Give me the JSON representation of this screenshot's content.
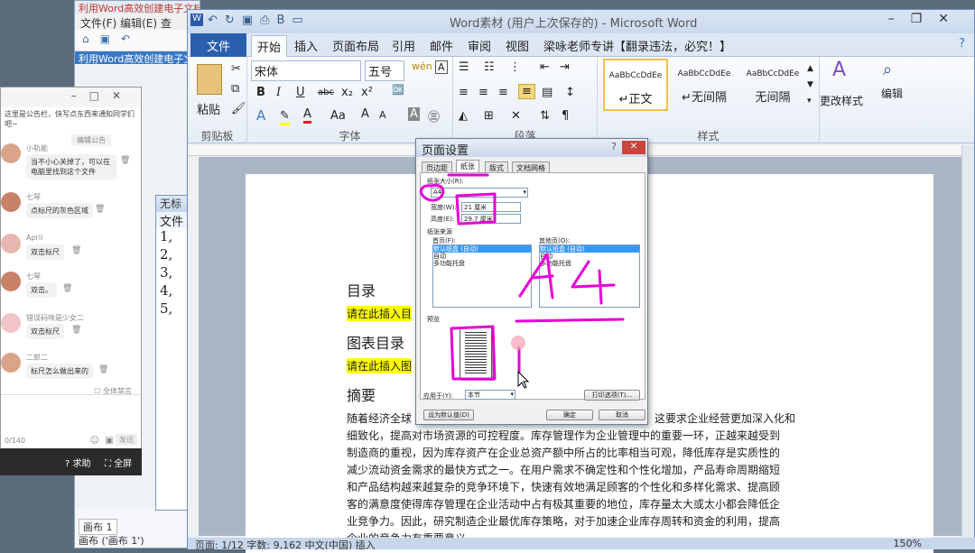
{
  "xmind": {
    "title": "利用Word高效创建电子文档.xmind",
    "menu": "文件(F)  编辑(E)  查",
    "tab": "利用Word高效创建电子文档",
    "sheet_tab": "画布 1",
    "status": "画布 ('画布 1')"
  },
  "subwin": {
    "title": "无标",
    "menu": "文件",
    "lines": [
      "1,",
      "2,",
      "3,",
      "4,",
      "5,"
    ]
  },
  "chat": {
    "notice": "这里是公告栏，快写点东西来通知同学们吧~",
    "notice_badge": "编辑公告",
    "messages": [
      {
        "name": "小轨能",
        "text": "当不小心关掉了，可以在电脑里找到这个文件"
      },
      {
        "name": "七琴",
        "text": "点标尺的灰色区域"
      },
      {
        "name": "April",
        "text": "双击标尺"
      },
      {
        "name": "七琴",
        "text": "双击。"
      },
      {
        "name": "错误码咪是少女二",
        "text": "双击标尺"
      },
      {
        "name": "二郎二",
        "text": "标尺怎么做出来的"
      }
    ],
    "mute_all": "全体禁言",
    "counter": "0/140",
    "send": "发送",
    "help": "求助",
    "fullscreen": "全屏"
  },
  "word": {
    "title": "Word素材 (用户上次保存的) - Microsoft Word",
    "tabs": [
      "文件",
      "开始",
      "插入",
      "页面布局",
      "引用",
      "邮件",
      "审阅",
      "视图",
      "梁咏老师专讲【翻录违法，必究！】"
    ],
    "clipboard": {
      "paste": "粘贴",
      "label": "剪贴板"
    },
    "font": {
      "name": "宋体",
      "size": "五号",
      "label": "字体"
    },
    "paragraph_label": "段落",
    "styles": {
      "label": "样式",
      "items": [
        {
          "preview": "AaBbCcDdEe",
          "name": "↵正文"
        },
        {
          "preview": "AaBbCcDdEe",
          "name": "↵无间隔"
        },
        {
          "preview": "AaBbCcDdEe",
          "name": "无间隔"
        }
      ],
      "change": "更改样式",
      "edit": "编辑"
    },
    "doc": {
      "toc": "目录",
      "toc_placeholder": "请在此插入目",
      "fig_toc": "图表目录",
      "fig_placeholder": "请在此插入图",
      "abstract": "摘要",
      "para_start": "随着经济全球",
      "para_right": "这要求企业经营更加深入化和",
      "lines": [
        "细致化，提高对市场资源的可控程度。库存管理作为企业管理中的重要一环，正越来越受到",
        "制造商的重视，因为库存资产在企业总资产额中所占的比率相当可观，降低库存是实质性的",
        "减少流动资金需求的最快方式之一。在用户需求不确定性和个性化增加，产品寿命周期缩短",
        "和产品结构越来越复杂的竞争环境下，快速有效地满足顾客的个性化和多样化需求、提高顾",
        "客的满意度使得库存管理在企业活动中占有极其重要的地位，库存量太大或太小都会降低企",
        "业竞争力。因此，研究制造企业最优库存策略，对于加速企业库存周转和资金的利用，提高",
        "企业的竞争力有重要意义。"
      ]
    },
    "status": "页面: 1/12   字数: 9,162   中文(中国)   插入",
    "zoom": "150%"
  },
  "dialog": {
    "title": "页面设置",
    "tabs": [
      "页边距",
      "纸张",
      "版式",
      "文档网格"
    ],
    "paper_size_label": "纸张大小(R):",
    "paper_size": "A4",
    "width_label": "宽度(W):",
    "width": "21 厘米",
    "height_label": "高度(E):",
    "height": "29.7 厘米",
    "source_label": "纸张来源",
    "first_page_label": "首页(F):",
    "other_pages_label": "其他页(O):",
    "trays": [
      "默认纸盒 (自动)",
      "自动",
      "多功能托盘"
    ],
    "preview_label": "预览",
    "apply_label": "应用于(Y):",
    "apply_value": "本节",
    "print_options": "打印选项(T)...",
    "set_default": "设为默认值(D)",
    "ok": "确定",
    "cancel": "取消"
  },
  "annotation": {
    "ink_color": "#e600d6"
  }
}
